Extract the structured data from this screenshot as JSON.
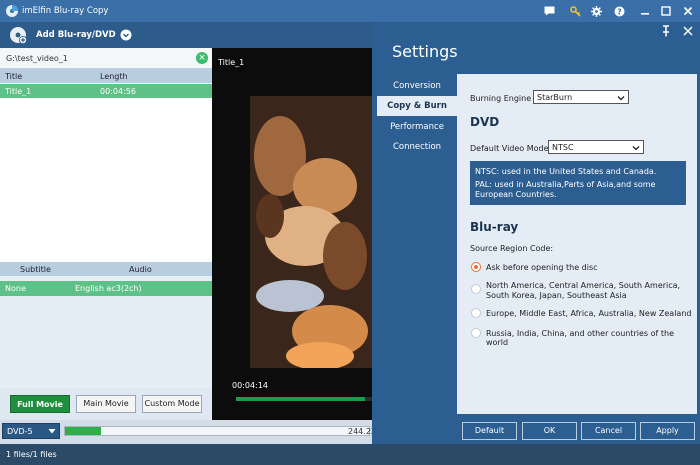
{
  "app": {
    "title": "imElfin Blu-ray Copy"
  },
  "toolbar": {
    "add_label": "Add Blu-ray/DVD"
  },
  "source": {
    "path": "G:\\test_video_1"
  },
  "titles": {
    "headers": {
      "title": "Title",
      "length": "Length"
    },
    "rows": [
      {
        "title": "Title_1",
        "length": "00:04:56"
      }
    ]
  },
  "tracks": {
    "headers": {
      "subtitle": "Subtitle",
      "audio": "Audio"
    },
    "rows": [
      {
        "subtitle": "None",
        "audio": "English ac3(2ch)"
      }
    ]
  },
  "modes": {
    "full": "Full Movie",
    "main": "Main Movie",
    "custom": "Custom Mode"
  },
  "video": {
    "title": "Title_1",
    "time": "00:04:14",
    "progress": 0.95
  },
  "disc": {
    "type": "DVD-5",
    "size": "244.23",
    "usage": 0.12
  },
  "status": {
    "files": "1 files/1 files"
  },
  "settings": {
    "heading": "Settings",
    "nav": [
      "Conversion",
      "Copy & Burn",
      "Performance",
      "Connection"
    ],
    "active_nav": "Copy & Burn",
    "burning_engine_label": "Burning Engine",
    "burning_engine_value": "StarBurn",
    "dvd_heading": "DVD",
    "video_mode_label": "Default Video Mode",
    "video_mode_value": "NTSC",
    "ntsc_note": "NTSC: used in the United States and Canada.",
    "pal_note": "PAL: used in Australia,Parts of Asia,and some European Countries.",
    "bluray_heading": "Blu-ray",
    "region_label": "Source Region Code:",
    "regions": [
      "Ask before opening the disc",
      "North America, Central America, South America, South Korea, Japan, Southeast Asia",
      "Europe, Middle East, Africa, Australia, New Zealand",
      "Russia, India, China, and other countries of the world"
    ],
    "selected_region": 0,
    "buttons": {
      "default": "Default",
      "ok": "OK",
      "cancel": "Cancel",
      "apply": "Apply"
    }
  },
  "colors": {
    "accent_green": "#1f8f3d",
    "selection_green": "#5ec187",
    "settings_blue": "#2c5e91",
    "radio_orange": "#f06b36"
  }
}
